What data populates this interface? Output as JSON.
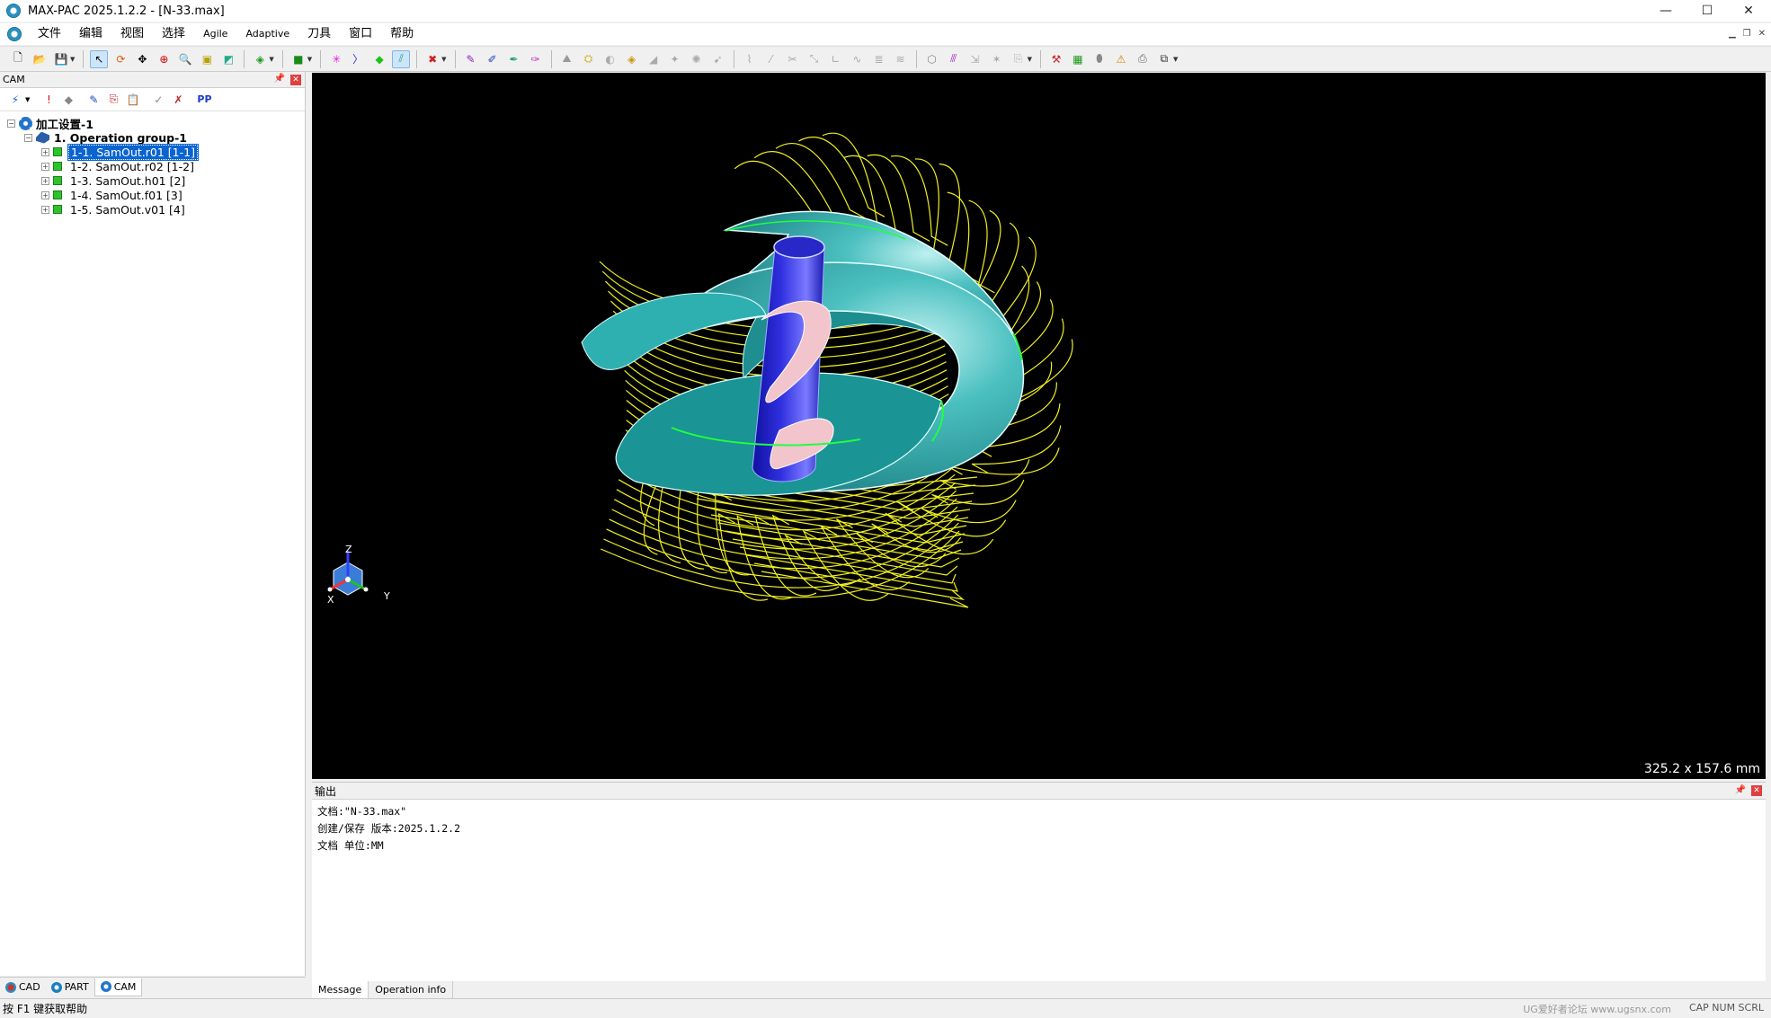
{
  "window": {
    "title": "MAX-PAC 2025.1.2.2 - [N-33.max]",
    "minimize": "—",
    "maximize": "☐",
    "close": "✕"
  },
  "menu": {
    "items": [
      "文件",
      "编辑",
      "视图",
      "选择",
      "Agile",
      "Adaptive",
      "刀具",
      "窗口",
      "帮助"
    ]
  },
  "cam_panel": {
    "title": "CAM",
    "pp_label": "PP",
    "tree": {
      "root": "加工设置-1",
      "group": "1. Operation group-1",
      "operations": [
        "1-1. SamOut.r01 [1-1]",
        "1-2. SamOut.r02 [1-2]",
        "1-3. SamOut.h01 [2]",
        "1-4. SamOut.f01 [3]",
        "1-5. SamOut.v01 [4]"
      ],
      "selected_index": 0
    },
    "tabs": [
      "CAD",
      "PART",
      "CAM"
    ]
  },
  "viewport": {
    "dimensions": "325.2 x 157.6 mm",
    "axes": {
      "z": "Z",
      "x": "X",
      "y": "Y"
    },
    "colors": {
      "background": "#000000",
      "toolpath": "#f0f020",
      "blade": "#2aa8a8",
      "hub": "#2020cc",
      "fillet": "#f0b8c0"
    }
  },
  "output": {
    "title": "输出",
    "lines": [
      "文档:\"N-33.max\"",
      "创建/保存 版本:2025.1.2.2",
      "文档 单位:MM"
    ],
    "tabs": [
      "Message",
      "Operation info"
    ]
  },
  "status": {
    "help": "按 F1 键获取帮助",
    "watermark": "UG爱好者论坛  www.ugsnx.com",
    "indicators": "CAP  NUM  SCRL"
  }
}
